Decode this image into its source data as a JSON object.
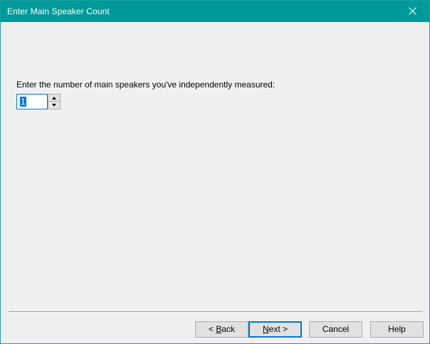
{
  "window": {
    "title": "Enter Main Speaker Count",
    "close_icon": "close-icon"
  },
  "content": {
    "prompt": "Enter the number of main speakers you've independently measured:",
    "speaker_count": {
      "value": "1",
      "up_icon": "triangle-up-icon",
      "down_icon": "triangle-down-icon"
    }
  },
  "footer": {
    "back_prefix": "< ",
    "back_mnemonic": "B",
    "back_rest": "ack",
    "next_mnemonic": "N",
    "next_rest": "ext >",
    "cancel_label": "Cancel",
    "help_label": "Help"
  },
  "colors": {
    "titlebar": "#009a9a",
    "accent": "#0078d7",
    "dialog_bg": "#f0f0f0",
    "button_bg": "#e1e1e1"
  }
}
